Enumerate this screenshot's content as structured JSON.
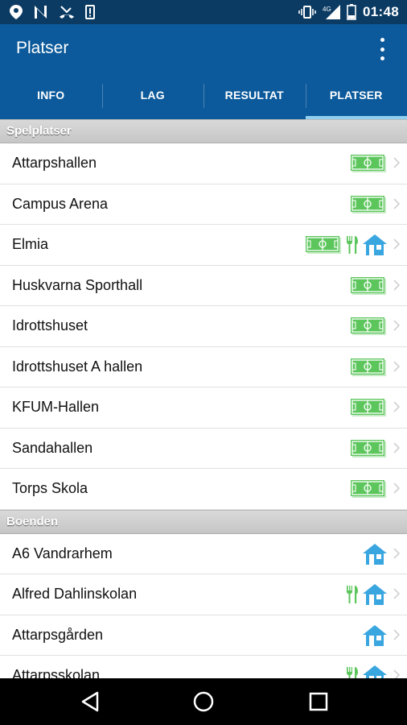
{
  "status_bar": {
    "time": "01:48",
    "left_icons": [
      "location-icon",
      "no-signal-n-icon",
      "missed-call-icon",
      "phone-icon"
    ],
    "right_icons": [
      "vibrate-icon",
      "4g-signal-icon",
      "battery-icon"
    ]
  },
  "app_bar": {
    "title": "Platser",
    "menu_icon": "overflow-menu-icon"
  },
  "tabs": [
    {
      "label": "INFO",
      "active": false
    },
    {
      "label": "LAG",
      "active": false
    },
    {
      "label": "RESULTAT",
      "active": false
    },
    {
      "label": "PLATSER",
      "active": true
    }
  ],
  "sections": [
    {
      "title": "Spelplatser",
      "items": [
        {
          "label": "Attarpshallen",
          "icons": [
            "field-icon"
          ]
        },
        {
          "label": "Campus Arena",
          "icons": [
            "field-icon"
          ]
        },
        {
          "label": "Elmia",
          "icons": [
            "field-icon",
            "restaurant-icon",
            "house-icon"
          ]
        },
        {
          "label": "Huskvarna Sporthall",
          "icons": [
            "field-icon"
          ]
        },
        {
          "label": "Idrottshuset",
          "icons": [
            "field-icon"
          ]
        },
        {
          "label": "Idrottshuset A hallen",
          "icons": [
            "field-icon"
          ]
        },
        {
          "label": "KFUM-Hallen",
          "icons": [
            "field-icon"
          ]
        },
        {
          "label": "Sandahallen",
          "icons": [
            "field-icon"
          ]
        },
        {
          "label": "Torps Skola",
          "icons": [
            "field-icon"
          ]
        }
      ]
    },
    {
      "title": "Boenden",
      "items": [
        {
          "label": "A6 Vandrarhem",
          "icons": [
            "house-icon"
          ]
        },
        {
          "label": "Alfred Dahlinskolan",
          "icons": [
            "restaurant-icon",
            "house-icon"
          ]
        },
        {
          "label": "Attarpsgården",
          "icons": [
            "house-icon"
          ]
        },
        {
          "label": "Attarpsskolan",
          "icons": [
            "restaurant-icon",
            "house-icon"
          ]
        }
      ]
    }
  ],
  "nav_bar": {
    "buttons": [
      "back-icon",
      "home-icon",
      "recents-icon"
    ]
  },
  "colors": {
    "status_bar": "#0b3b63",
    "app_bar": "#0c5a9b",
    "tab_indicator": "#8fd0f0",
    "field_icon": "#5cc65c",
    "house_icon": "#3aa6e0"
  }
}
